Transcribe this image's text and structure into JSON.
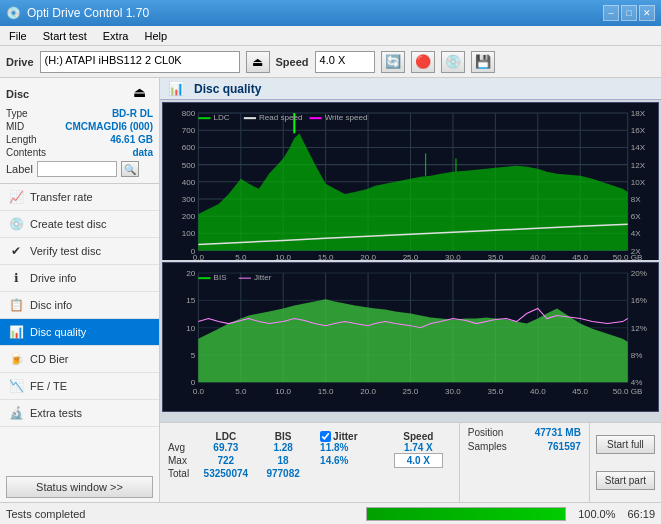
{
  "app": {
    "title": "Opti Drive Control 1.70",
    "icon": "💿"
  },
  "titlebar": {
    "minimize": "–",
    "maximize": "□",
    "close": "✕"
  },
  "menu": {
    "items": [
      "File",
      "Start test",
      "Extra",
      "Help"
    ]
  },
  "toolbar": {
    "drive_label": "Drive",
    "drive_value": "(H:) ATAPI iHBS112  2 CL0K",
    "speed_label": "Speed",
    "speed_value": "4.0 X",
    "eject_icon": "⏏"
  },
  "disc": {
    "title": "Disc",
    "type_label": "Type",
    "type_value": "BD-R DL",
    "mid_label": "MID",
    "mid_value": "CMCMAGDI6 (000)",
    "length_label": "Length",
    "length_value": "46.61 GB",
    "contents_label": "Contents",
    "contents_value": "data",
    "label_label": "Label"
  },
  "nav": {
    "items": [
      {
        "id": "transfer-rate",
        "label": "Transfer rate",
        "icon": "📈"
      },
      {
        "id": "create-test-disc",
        "label": "Create test disc",
        "icon": "💿"
      },
      {
        "id": "verify-test-disc",
        "label": "Verify test disc",
        "icon": "✔"
      },
      {
        "id": "drive-info",
        "label": "Drive info",
        "icon": "ℹ"
      },
      {
        "id": "disc-info",
        "label": "Disc info",
        "icon": "📋"
      },
      {
        "id": "disc-quality",
        "label": "Disc quality",
        "icon": "📊",
        "active": true
      },
      {
        "id": "cd-bier",
        "label": "CD Bier",
        "icon": "🍺"
      },
      {
        "id": "fe-te",
        "label": "FE / TE",
        "icon": "📉"
      },
      {
        "id": "extra-tests",
        "label": "Extra tests",
        "icon": "🔬"
      }
    ],
    "status_btn": "Status window >>"
  },
  "chart": {
    "title": "Disc quality",
    "top": {
      "legend": [
        "LDC",
        "Read speed",
        "Write speed"
      ],
      "y_axis_left": [
        800,
        700,
        600,
        500,
        400,
        300,
        200,
        100,
        0
      ],
      "y_axis_right": [
        "18X",
        "16X",
        "14X",
        "12X",
        "10X",
        "8X",
        "6X",
        "4X",
        "2X"
      ],
      "x_axis": [
        "0.0",
        "5.0",
        "10.0",
        "15.0",
        "20.0",
        "25.0",
        "30.0",
        "35.0",
        "40.0",
        "45.0",
        "50.0 GB"
      ]
    },
    "bottom": {
      "legend": [
        "BIS",
        "Jitter"
      ],
      "y_axis_left": [
        20,
        15,
        10,
        5,
        0
      ],
      "y_axis_right": [
        "20%",
        "16%",
        "12%",
        "8%",
        "4%"
      ],
      "x_axis": [
        "0.0",
        "5.0",
        "10.0",
        "15.0",
        "20.0",
        "25.0",
        "30.0",
        "35.0",
        "40.0",
        "45.0",
        "50.0 GB"
      ]
    }
  },
  "stats": {
    "columns": [
      "LDC",
      "BIS",
      "",
      "Jitter",
      "Speed",
      ""
    ],
    "avg_label": "Avg",
    "avg_ldc": "69.73",
    "avg_bis": "1.28",
    "avg_jitter": "11.8%",
    "avg_speed": "1.74 X",
    "max_label": "Max",
    "max_ldc": "722",
    "max_bis": "18",
    "max_jitter": "14.6%",
    "max_speed": "4.0 X",
    "total_label": "Total",
    "total_ldc": "53250074",
    "total_bis": "977082",
    "jitter_checked": true,
    "jitter_label": "Jitter",
    "position_label": "Position",
    "position_value": "47731 MB",
    "samples_label": "Samples",
    "samples_value": "761597"
  },
  "buttons": {
    "start_full": "Start full",
    "start_part": "Start part"
  },
  "statusbar": {
    "text": "Tests completed",
    "progress": 100,
    "progress_text": "100.0%",
    "right_text": "66:19"
  }
}
